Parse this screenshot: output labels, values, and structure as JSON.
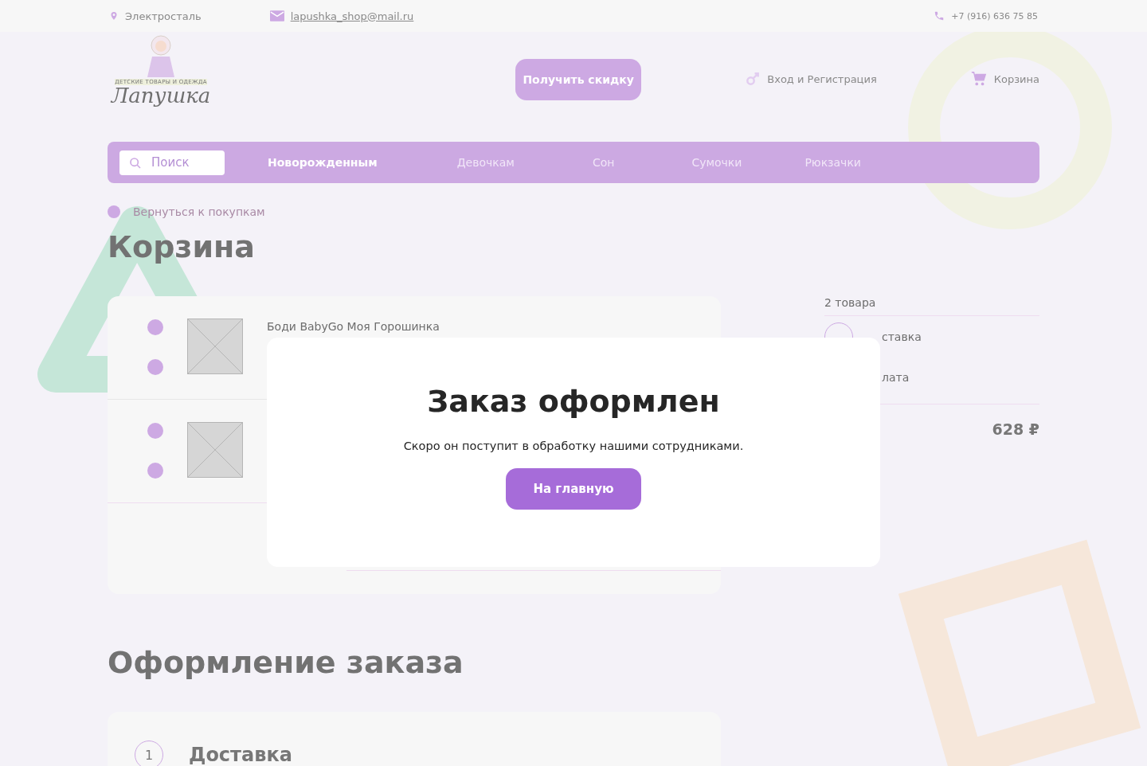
{
  "top_bar": {
    "city": "Электросталь",
    "email": "lapushka_shop@mail.ru",
    "phone": "+7 (916) 636 75 85"
  },
  "header": {
    "logo": {
      "tagline": "ДЕТСКИЕ ТОВАРЫ И ОДЕЖДА",
      "name": "Лапушка"
    },
    "discount_button": "Получить скидку",
    "login": "Вход и Регистрация",
    "cart": "Корзина"
  },
  "nav": {
    "search": {
      "placeholder": "Поиск"
    },
    "items": [
      {
        "label": "Новорожденным",
        "selected": true
      },
      {
        "label": "Девочкам",
        "selected": false
      },
      {
        "label": "Сон",
        "selected": false
      },
      {
        "label": "Сумочки",
        "selected": false
      },
      {
        "label": "Рюкзачки",
        "selected": false
      }
    ]
  },
  "back_link": "Вернуться к покупкам",
  "title": "Корзина",
  "cart_items": [
    {
      "kind": "product",
      "name": "Боди BabyGo Моя Горошинка"
    },
    {
      "kind": "product"
    }
  ],
  "summary": {
    "count": "2 товара",
    "options": [
      {
        "label": "ставка",
        "selected": false
      },
      {
        "label": "лата"
      }
    ],
    "total": "628 ₽"
  },
  "checkout": {
    "title": "Оформление заказа",
    "steps": [
      {
        "number": "1",
        "title": "Доставка"
      }
    ]
  },
  "modal": {
    "title": "Заказ оформлен",
    "text": "Скоро он поступит в обработку нашими сотрудниками.",
    "button": "На главную"
  }
}
